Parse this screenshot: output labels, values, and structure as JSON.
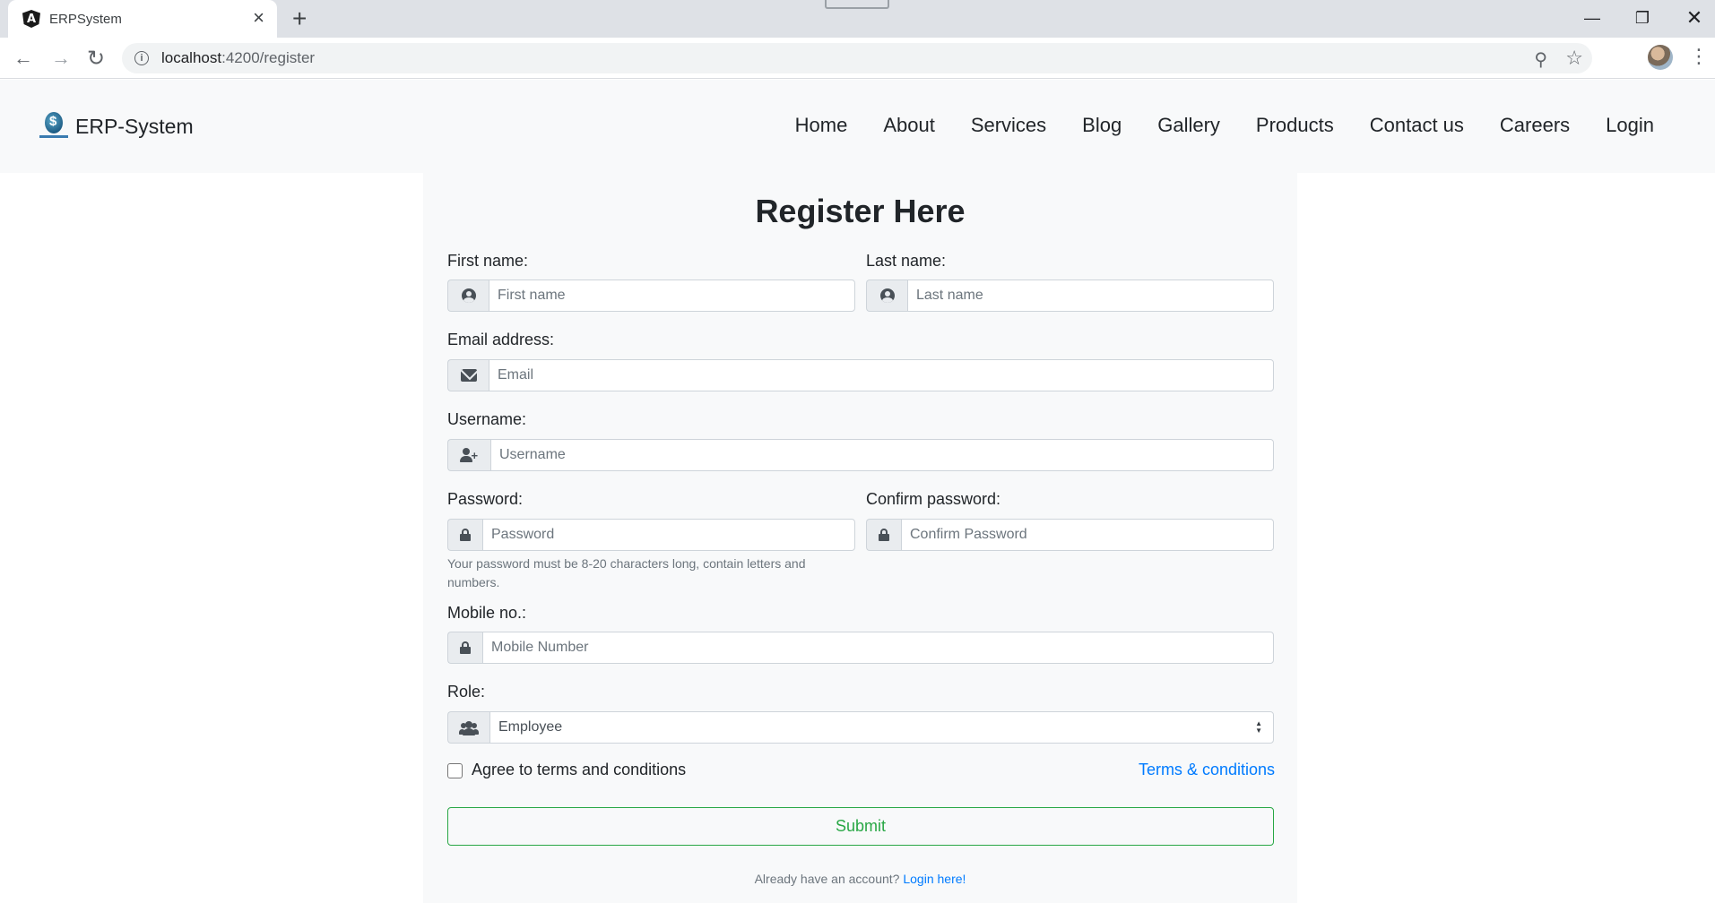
{
  "browser": {
    "tab_title": "ERPSystem",
    "tab_favicon_letter": "A",
    "new_tab_label": "+",
    "url_host": "localhost",
    "url_path": ":4200/register",
    "window_controls": {
      "minimize": "—",
      "maximize": "❐",
      "close": "✕"
    }
  },
  "navbar": {
    "brand_name": "ERP-System",
    "links": [
      "Home",
      "About",
      "Services",
      "Blog",
      "Gallery",
      "Products",
      "Contact us",
      "Careers",
      "Login"
    ]
  },
  "form": {
    "title": "Register Here",
    "first_name": {
      "label": "First name:",
      "placeholder": "First name",
      "icon": "user-circle-icon"
    },
    "last_name": {
      "label": "Last name:",
      "placeholder": "Last name",
      "icon": "user-circle-icon"
    },
    "email": {
      "label": "Email address:",
      "placeholder": "Email",
      "icon": "envelope-icon"
    },
    "username": {
      "label": "Username:",
      "placeholder": "Username",
      "icon": "user-plus-icon"
    },
    "password": {
      "label": "Password:",
      "placeholder": "Password",
      "icon": "lock-icon",
      "help": "Your password must be 8-20 characters long, contain letters and numbers."
    },
    "confirm_password": {
      "label": "Confirm password:",
      "placeholder": "Confirm Password",
      "icon": "lock-icon"
    },
    "mobile": {
      "label": "Mobile no.:",
      "placeholder": "Mobile Number",
      "icon": "lock-icon"
    },
    "role": {
      "label": "Role:",
      "selected": "Employee",
      "icon": "users-icon"
    },
    "agree_label": "Agree to terms and conditions",
    "agree_checked": false,
    "terms_link": "Terms & conditions",
    "submit_label": "Submit",
    "footer_text": "Already have an account?",
    "footer_link": "Login here!"
  },
  "colors": {
    "primary_link": "#007bff",
    "success": "#28a745",
    "card_bg": "#f8f9fa"
  }
}
